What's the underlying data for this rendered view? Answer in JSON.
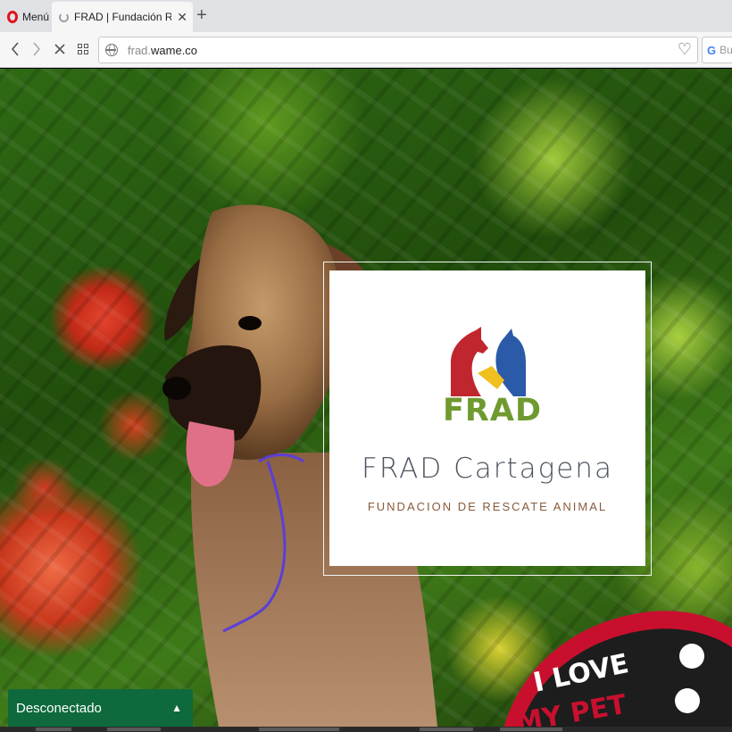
{
  "browser": {
    "menu_label": "Menú",
    "tab": {
      "title": "FRAD | Fundación Rescate"
    },
    "address": {
      "host_prefix": "frad.",
      "host_domain": "wame.co"
    },
    "search_placeholder": "Bu"
  },
  "card": {
    "logo_text": "FRAD",
    "title": "FRAD Cartagena",
    "subtitle": "FUNDACION DE RESCATE ANIMAL"
  },
  "cap": {
    "text_top": "I LOVE",
    "text_bottom": "MY PET"
  },
  "status_bar": {
    "label": "Desconectado"
  },
  "colors": {
    "accent_red": "#e0141e",
    "status_green": "#0e6a3c",
    "logo_green": "#6f9a2f",
    "logo_red": "#c0262e",
    "logo_blue": "#2a5aa8",
    "logo_yellow": "#f0c020"
  },
  "icons": {
    "menu": "opera-logo-icon",
    "tab_loading": "loading-spinner-icon",
    "tab_close": "close-icon",
    "new_tab": "plus-icon",
    "back": "chevron-left-icon",
    "forward": "chevron-right-icon",
    "stop": "stop-icon",
    "speed_dial": "grid-icon",
    "site": "globe-icon",
    "bookmark": "heart-icon",
    "search_engine": "google-g-icon",
    "expand": "chevron-up-icon"
  }
}
